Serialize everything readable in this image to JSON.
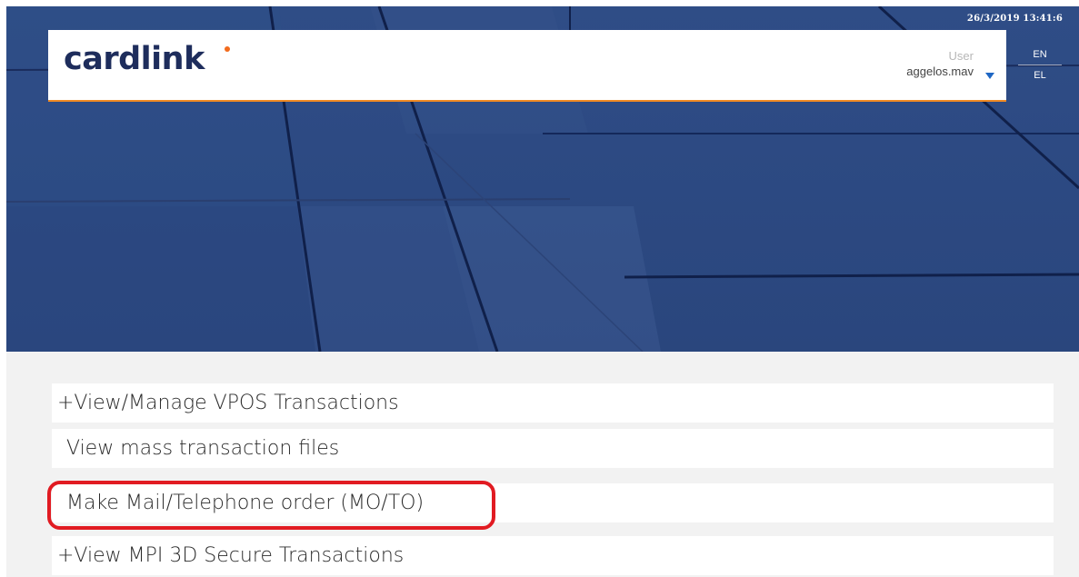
{
  "header": {
    "timestamp": "26/3/2019 13:41:6",
    "logo_text": "cardlink",
    "user_label": "User",
    "user_name": "aggelos.mav"
  },
  "languages": [
    "EN",
    "EL"
  ],
  "menu": {
    "items": [
      {
        "label": "+View/Manage VPOS Transactions"
      },
      {
        "label": "View mass transaction files"
      },
      {
        "label": "Make Mail/Telephone order (MO/TO)",
        "highlighted": true
      },
      {
        "label": "+View MPI 3D Secure Transactions"
      }
    ]
  },
  "colors": {
    "brand_navy": "#1e2d5c",
    "accent_orange": "#f08a24",
    "hero_blue": "#2d4a83",
    "highlight_red": "#e11b22"
  },
  "icons": {
    "user_dropdown": "caret-down-icon"
  }
}
